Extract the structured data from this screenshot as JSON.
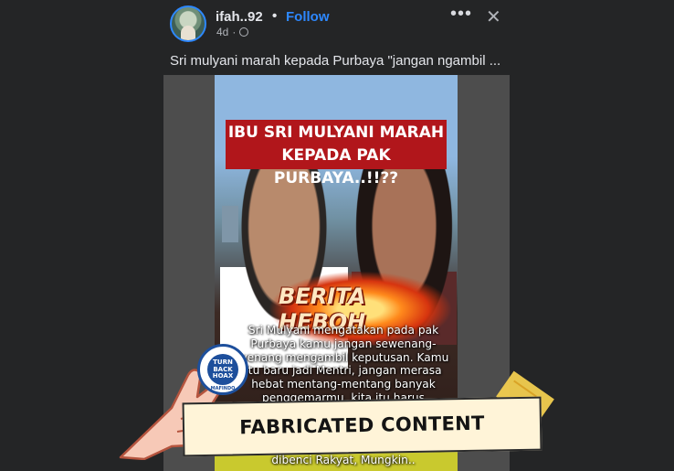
{
  "post": {
    "author": "ifah..92",
    "separator": "•",
    "follow_label": "Follow",
    "time_ago": "4d",
    "meta_dot": "·",
    "more_icon": "•••",
    "close_icon": "✕",
    "caption": "Sri mulyani marah kepada Purbaya \"jangan ngambil ..."
  },
  "media": {
    "headline_line1": "IBU SRI MULYANI MARAH",
    "headline_line2": "KEPADA PAK PURBAYA..!!??",
    "banner_text": "BERITA HEBOH",
    "body_text": "Sri Mulyani mengatakan pada pak Purbaya kamu jangan sewenang-wenang mengambil keputusan. Kamu itu baru jadi Mentri, jangan merasa hebat mentang-mentang banyak penggemarmu, kita itu harus dengarkan Saran-saran DPR dan Mentri lain Untuk",
    "bottom_text": "dibenci Rakyat, Mungkin..",
    "badge_text_1": "TURN",
    "badge_text_2": "BACK",
    "badge_text_3": "HOAX",
    "badge_org": "MAFINDO"
  },
  "fact_check": {
    "label": "FABRICATED CONTENT"
  },
  "colors": {
    "background": "#242526",
    "link": "#2d88ff",
    "headline_bg": "#b1161b",
    "label_bg": "#fff4d8",
    "tape": "#f2cd4f"
  }
}
